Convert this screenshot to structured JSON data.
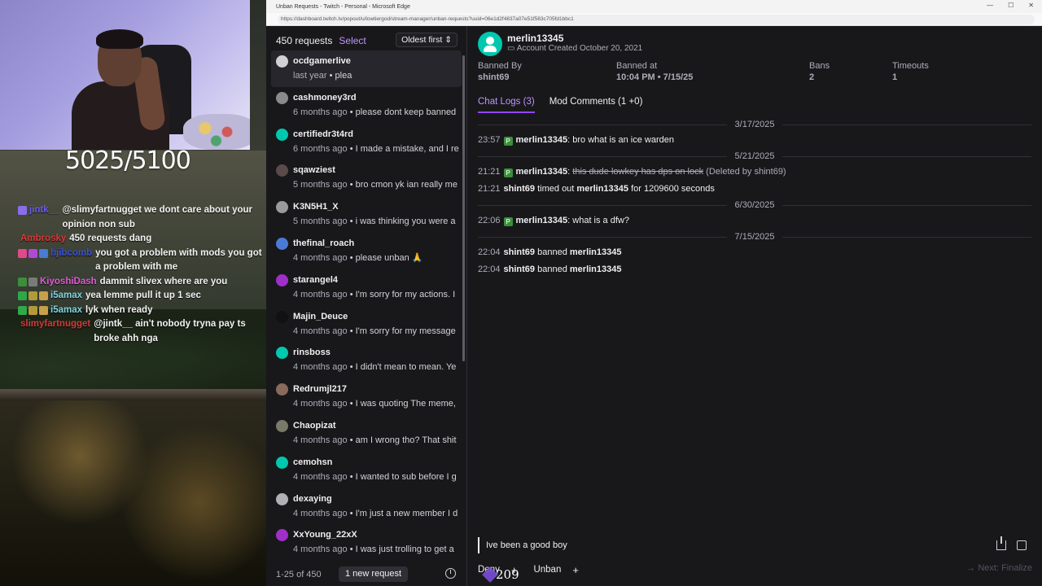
{
  "window": {
    "title": "Unban Requests - Twitch - Personal - Microsoft Edge",
    "url": "https://dashboard.twitch.tv/popout/u/lowtiergod/stream-manager/unban-requests?uuid=06e1d2f4837a07e51f583c705fd1bbc1"
  },
  "stream": {
    "goal": "5025/5100",
    "cheer": "209",
    "chat": [
      {
        "user": "jintk__",
        "color": "#6b5cf0",
        "text": "@slimyfartnugget we dont care about your opinion non sub",
        "badges": [
          "#8a6de8"
        ]
      },
      {
        "user": "Ambrosky",
        "color": "#d43a3a",
        "text": "450 requests dang",
        "badges": []
      },
      {
        "user": "hjibcomb",
        "color": "#3a4fd4",
        "text": "you got a problem with mods you got a problem with me",
        "badges": [
          "#e04a8a",
          "#b04ad4",
          "#4a7ad4"
        ]
      },
      {
        "user": "KiyoshiDash",
        "color": "#e05ad8",
        "text": "dammit slivex where are you",
        "badges": [
          "#3c8e3c",
          "#7a7a7a"
        ]
      },
      {
        "user": "i5amax",
        "color": "#7fd2e0",
        "text": "yea lemme pull it up 1 sec",
        "badges": [
          "#2fa84a",
          "#b09a3a",
          "#c8a04a"
        ]
      },
      {
        "user": "i5amax",
        "color": "#7fd2e0",
        "text": "lyk when ready",
        "badges": [
          "#2fa84a",
          "#b09a3a",
          "#c8a04a"
        ]
      },
      {
        "user": "slimyfartnugget",
        "color": "#d43a3a",
        "text": "@jintk__ ain't nobody tryna pay ts broke ahh nga",
        "badges": []
      }
    ]
  },
  "list": {
    "count": "450 requests",
    "select": "Select",
    "sort": "Oldest first",
    "items": [
      {
        "name": "ocdgamerlive",
        "ago": "last year",
        "msg": "plea",
        "color": "#d0d0d5",
        "active": true
      },
      {
        "name": "cashmoney3rd",
        "ago": "6 months ago",
        "msg": "please dont keep banned",
        "color": "#8a8a8a"
      },
      {
        "name": "certifiedr3t4rd",
        "ago": "6 months ago",
        "msg": "I made a mistake, and I re",
        "color": "#00c8af"
      },
      {
        "name": "sqawziest",
        "ago": "5 months ago",
        "msg": "bro cmon yk ian really me",
        "color": "#5a4a4a"
      },
      {
        "name": "K3N5H1_X",
        "ago": "5 months ago",
        "msg": "i was thinking you were a",
        "color": "#9a9a9a"
      },
      {
        "name": "thefinal_roach",
        "ago": "4 months ago",
        "msg": "please unban 🙏",
        "color": "#4a7ad4"
      },
      {
        "name": "starangel4",
        "ago": "4 months ago",
        "msg": "I'm sorry for my actions. I",
        "color": "#9f2fc8"
      },
      {
        "name": "Majin_Deuce",
        "ago": "4 months ago",
        "msg": "I'm sorry for my message",
        "color": "#111111"
      },
      {
        "name": "rinsboss",
        "ago": "4 months ago",
        "msg": "I didn't mean to mean. Ye",
        "color": "#00c8af"
      },
      {
        "name": "Redrumjl217",
        "ago": "4 months ago",
        "msg": "I was quoting The meme,",
        "color": "#8a6a5a"
      },
      {
        "name": "Chaopizat",
        "ago": "4 months ago",
        "msg": "am I wrong tho? That shit",
        "color": "#7a7a6a"
      },
      {
        "name": "cemohsn",
        "ago": "4 months ago",
        "msg": "I wanted to sub before I g",
        "color": "#00c8af"
      },
      {
        "name": "dexaying",
        "ago": "4 months ago",
        "msg": "I'm just a new member I d",
        "color": "#b0b0b5"
      },
      {
        "name": "XxYoung_22xX",
        "ago": "4 months ago",
        "msg": "I was just trolling to get a",
        "color": "#9f2fc8"
      }
    ],
    "pager": "1-25 of 450",
    "new_request": "1 new request"
  },
  "detail": {
    "username": "merlin13345",
    "created": "Account Created October 20, 2021",
    "banned_by_label": "Banned By",
    "banned_by": "shint69",
    "banned_at_label": "Banned at",
    "banned_at": "10:04 PM • 7/15/25",
    "bans_label": "Bans",
    "bans": "2",
    "timeouts_label": "Timeouts",
    "timeouts": "1",
    "tab_chat": "Chat Logs (3)",
    "tab_mod": "Mod Comments (1 +0)",
    "logs": [
      {
        "date": "3/17/2025"
      },
      {
        "time": "23:57",
        "vip": true,
        "user": "merlin13345",
        "text": "bro what is an ice warden"
      },
      {
        "date": "5/21/2025"
      },
      {
        "time": "21:21",
        "vip": true,
        "user": "merlin13345",
        "strike": "this dude lowkey has dps on lock",
        "note": "(Deleted by shint69)"
      },
      {
        "time": "21:21",
        "actor": "shint69",
        "action": "timed out",
        "target": "merlin13345",
        "suffix": "for 1209600 seconds"
      },
      {
        "date": "6/30/2025"
      },
      {
        "time": "22:06",
        "vip": true,
        "user": "merlin13345",
        "text": "what is a dfw?"
      },
      {
        "date": "7/15/2025"
      },
      {
        "time": "22:04",
        "actor": "shint69",
        "action": "banned",
        "target": "merlin13345"
      },
      {
        "time": "22:04",
        "actor": "shint69",
        "action": "banned",
        "target": "merlin13345"
      }
    ],
    "reason": "Ive been a good boy",
    "deny": "Deny",
    "unban": "Unban",
    "next": "Next: Finalize"
  }
}
